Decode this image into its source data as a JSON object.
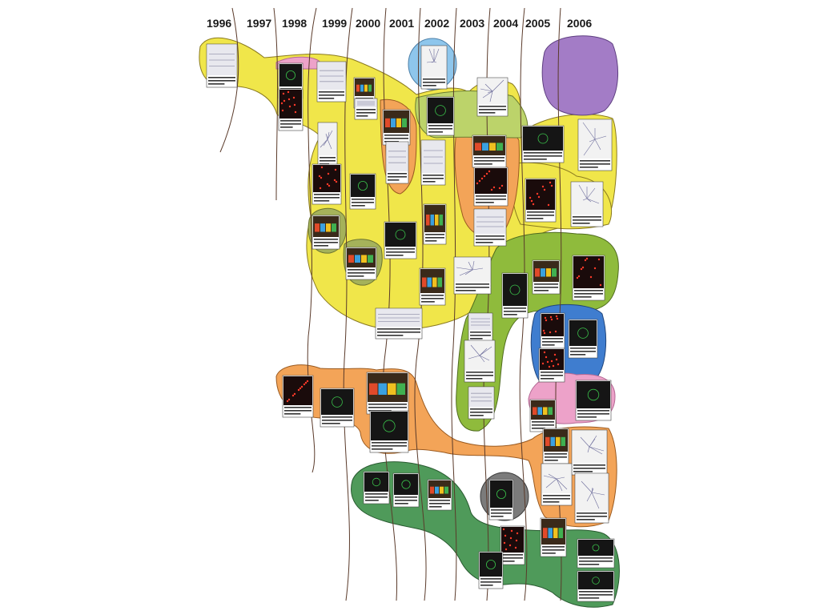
{
  "years": [
    "1996",
    "1997",
    "1998",
    "1999",
    "2000",
    "2001",
    "2002",
    "2003",
    "2004",
    "2005",
    "2006"
  ],
  "region_colors": {
    "yellow": "#f0e64a",
    "orange": "#f3a458",
    "green": "#8fbb3c",
    "dark_green": "#4f9a5a",
    "blue": "#3f7dcf",
    "light_blue": "#8ec6ec",
    "purple": "#a37cc6",
    "pink": "#eda2c9",
    "gray": "#7b7b7b",
    "olive": "#a5b25a"
  },
  "thumbnail_styles": [
    "light",
    "dark",
    "red-dots",
    "network",
    "colorful"
  ]
}
